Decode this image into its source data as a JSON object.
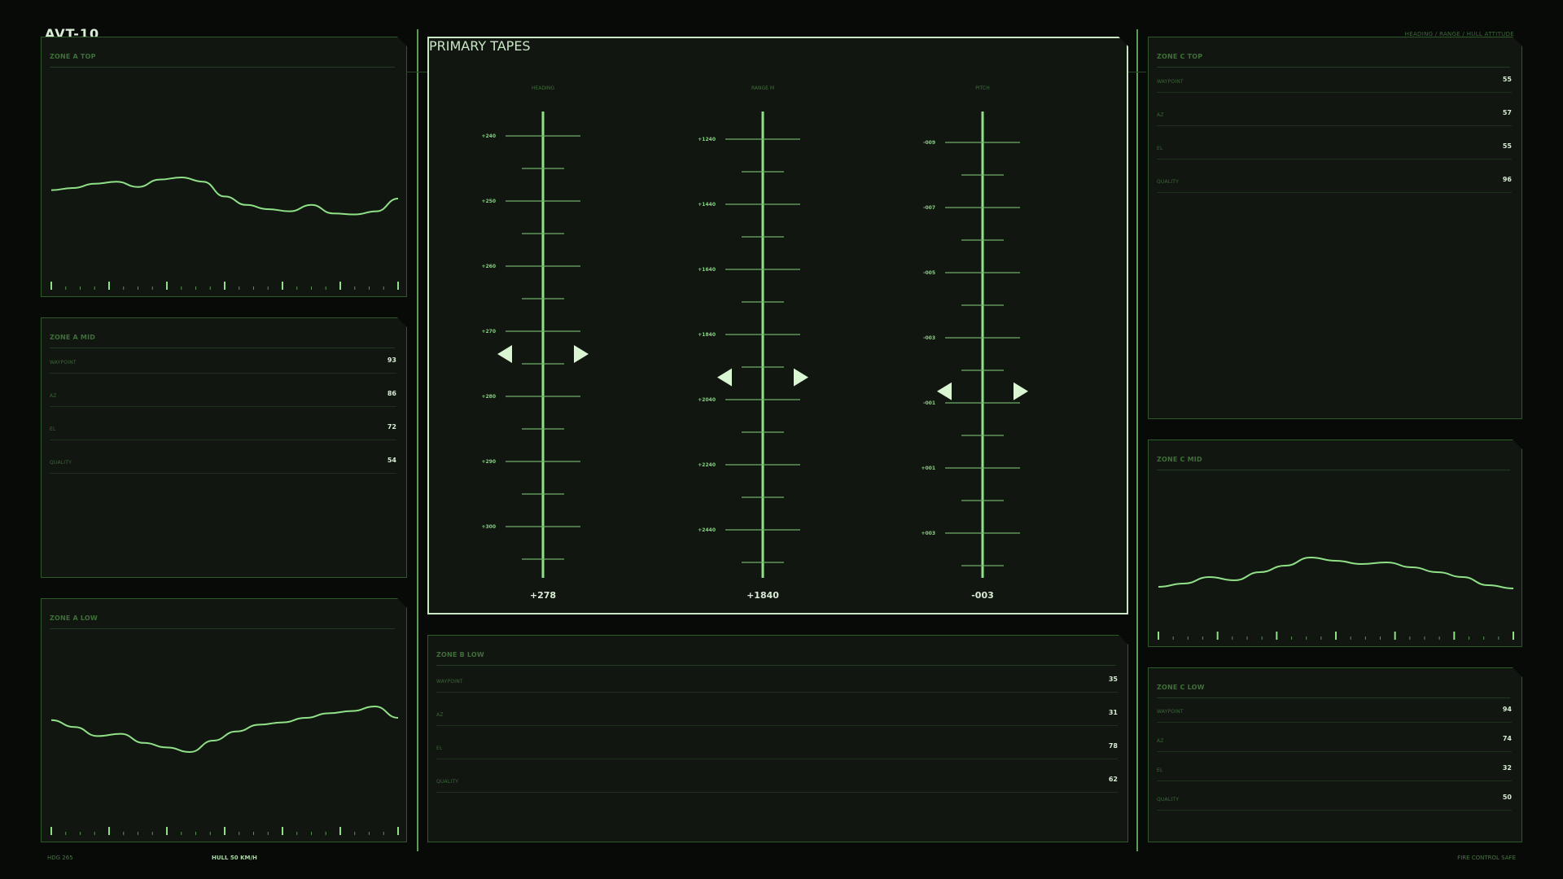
{
  "app": {
    "title": "AVT-10",
    "subtitle": "HEADING / RANGE / HULL ATTITUDE"
  },
  "colors": {
    "accent": "#8fe086",
    "text": "#d8ebd4",
    "panel": "#111710",
    "border": "#2e5a2a",
    "marker": "#d9f5d2"
  },
  "zones": {
    "a_top": {
      "label": "ZONE A TOP",
      "trace": [
        0.52,
        0.5,
        0.46,
        0.44,
        0.49,
        0.42,
        0.4,
        0.44,
        0.58,
        0.66,
        0.7,
        0.72,
        0.66,
        0.74,
        0.75,
        0.72,
        0.6
      ]
    },
    "a_mid": {
      "label": "ZONE A MID",
      "rows": [
        {
          "key": "WAYPOINT",
          "value": "93"
        },
        {
          "key": "AZ",
          "value": "86"
        },
        {
          "key": "EL",
          "value": "72"
        },
        {
          "key": "QUALITY",
          "value": "54"
        }
      ]
    },
    "a_low": {
      "label": "ZONE A LOW",
      "trace": [
        0.42,
        0.48,
        0.56,
        0.54,
        0.62,
        0.66,
        0.7,
        0.6,
        0.52,
        0.46,
        0.44,
        0.4,
        0.36,
        0.34,
        0.3,
        0.4
      ]
    },
    "b_low": {
      "label": "ZONE B LOW",
      "rows": [
        {
          "key": "WAYPOINT",
          "value": "35"
        },
        {
          "key": "AZ",
          "value": "31"
        },
        {
          "key": "EL",
          "value": "78"
        },
        {
          "key": "QUALITY",
          "value": "62"
        }
      ]
    },
    "c_top": {
      "label": "ZONE C TOP",
      "rows": [
        {
          "key": "WAYPOINT",
          "value": "55"
        },
        {
          "key": "AZ",
          "value": "57"
        },
        {
          "key": "EL",
          "value": "55"
        },
        {
          "key": "QUALITY",
          "value": "96"
        }
      ]
    },
    "c_mid": {
      "label": "ZONE C MID",
      "trace": [
        0.7,
        0.66,
        0.58,
        0.62,
        0.52,
        0.44,
        0.34,
        0.38,
        0.42,
        0.4,
        0.46,
        0.52,
        0.58,
        0.68,
        0.72
      ]
    },
    "c_low": {
      "label": "ZONE C LOW",
      "rows": [
        {
          "key": "WAYPOINT",
          "value": "94"
        },
        {
          "key": "AZ",
          "value": "74"
        },
        {
          "key": "EL",
          "value": "32"
        },
        {
          "key": "QUALITY",
          "value": "50"
        }
      ]
    }
  },
  "primary": {
    "label": "PRIMARY TAPES",
    "tapes": [
      {
        "name": "HEADING",
        "value": "+278",
        "ticks": [
          "+240",
          "+250",
          "+260",
          "+270",
          "+280",
          "+290",
          "+300"
        ],
        "marker": 0.52
      },
      {
        "name": "RANGE M",
        "value": "+1840",
        "ticks": [
          "+1240",
          "+1440",
          "+1640",
          "+1840",
          "+2040",
          "+2240",
          "+2440"
        ],
        "marker": 0.57
      },
      {
        "name": "PITCH",
        "value": "-003",
        "ticks": [
          "-009",
          "-007",
          "-005",
          "-003",
          "-001",
          "+001",
          "+003"
        ],
        "marker": 0.6
      }
    ]
  },
  "footer": {
    "left": "HDG 265",
    "hull": "HULL 50 KM/H",
    "right": "FIRE CONTROL SAFE"
  }
}
